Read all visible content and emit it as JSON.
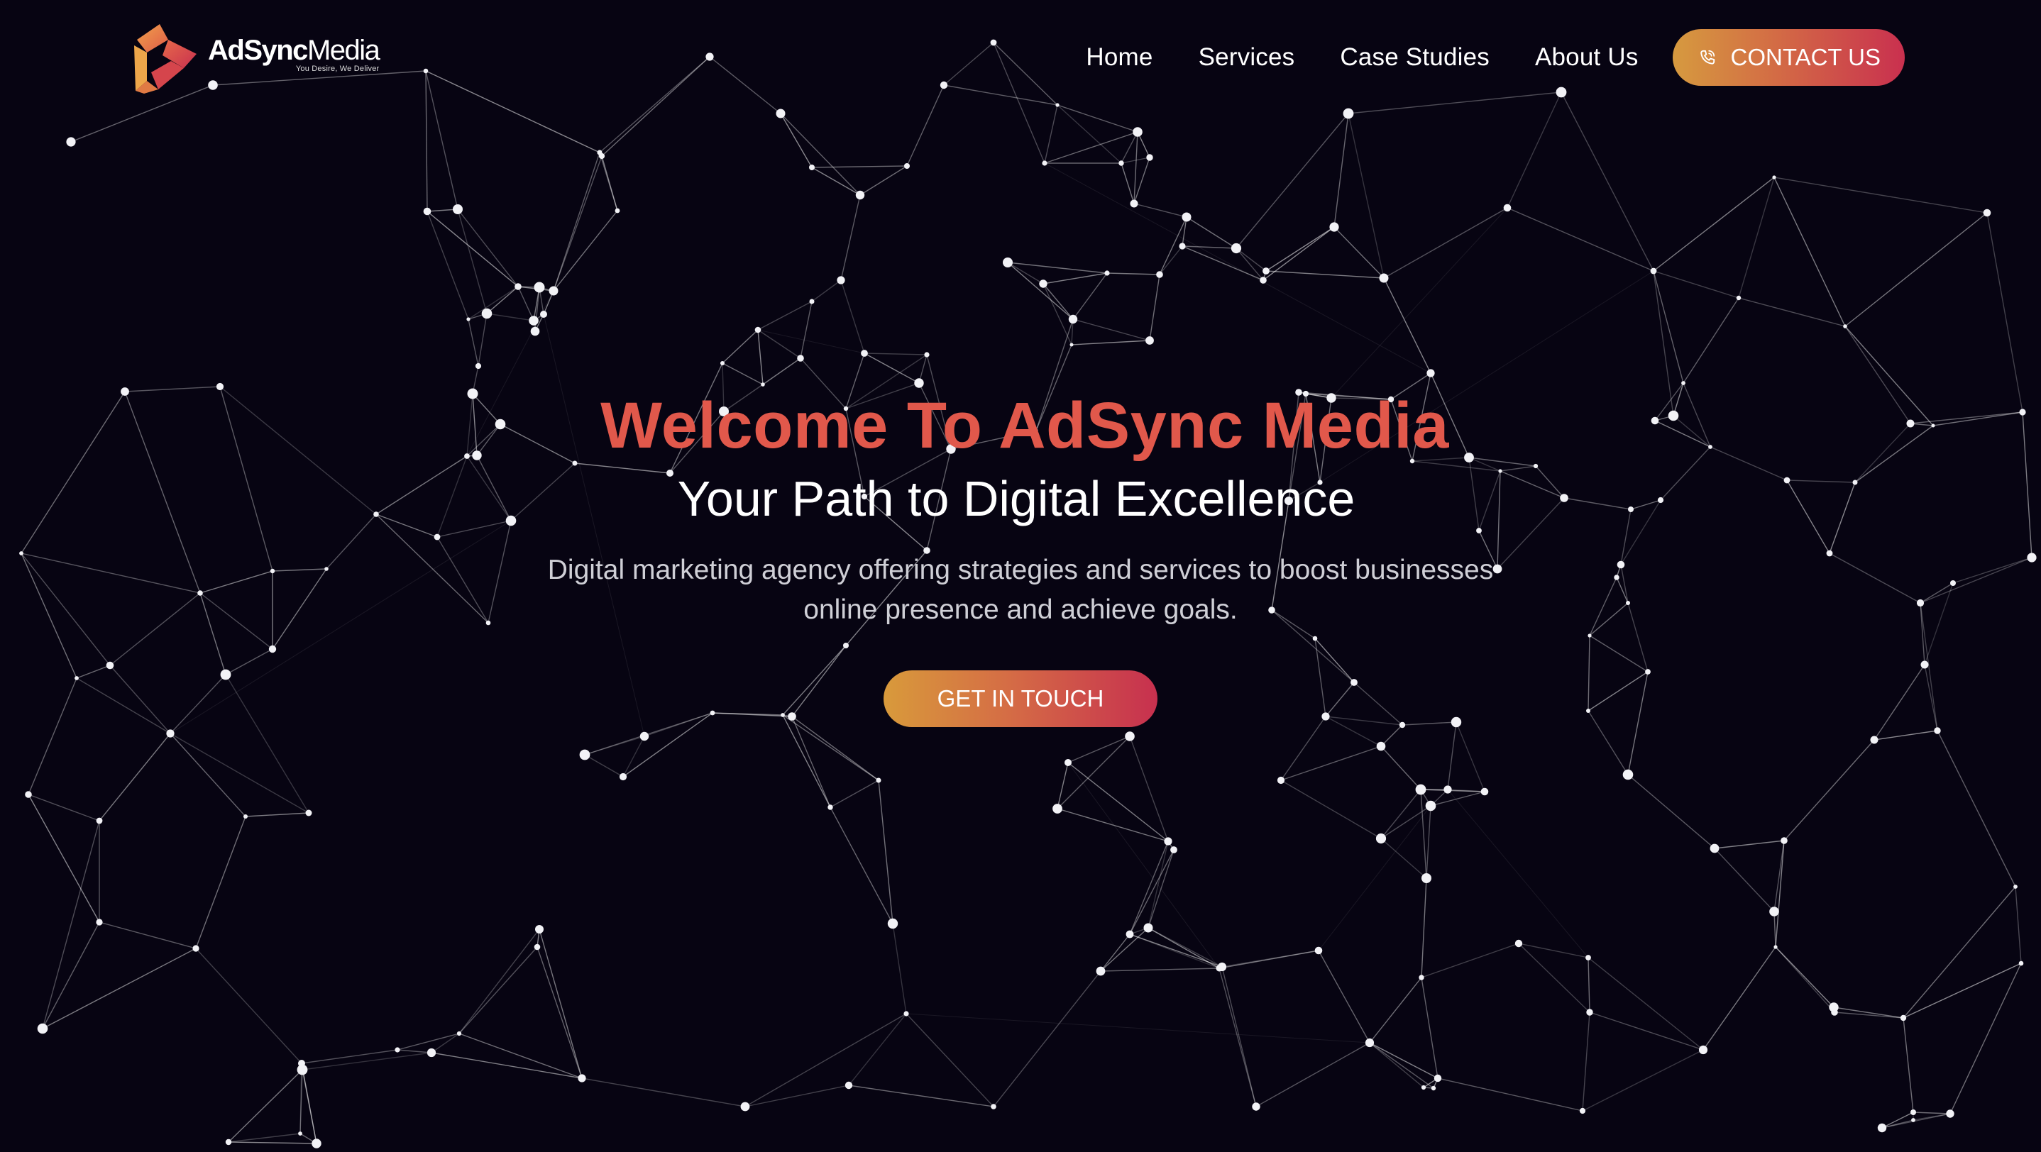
{
  "brand": {
    "name_bold": "AdSync",
    "name_light": "Media",
    "tagline": "You Desire, We Deliver"
  },
  "nav": {
    "links": [
      "Home",
      "Services",
      "Case Studies",
      "About Us"
    ],
    "contact_label": "CONTACT US"
  },
  "hero": {
    "title": "Welcome To AdSync Media",
    "subtitle": "Your Path to Digital Excellence",
    "description": "Digital marketing agency offering strategies and services to boost businesses online presence and achieve goals.",
    "cta_label": "GET IN TOUCH"
  },
  "colors": {
    "background": "#070412",
    "accent": "#e1584b",
    "gradient_start": "#d69a3f",
    "gradient_end": "#c9304f"
  }
}
